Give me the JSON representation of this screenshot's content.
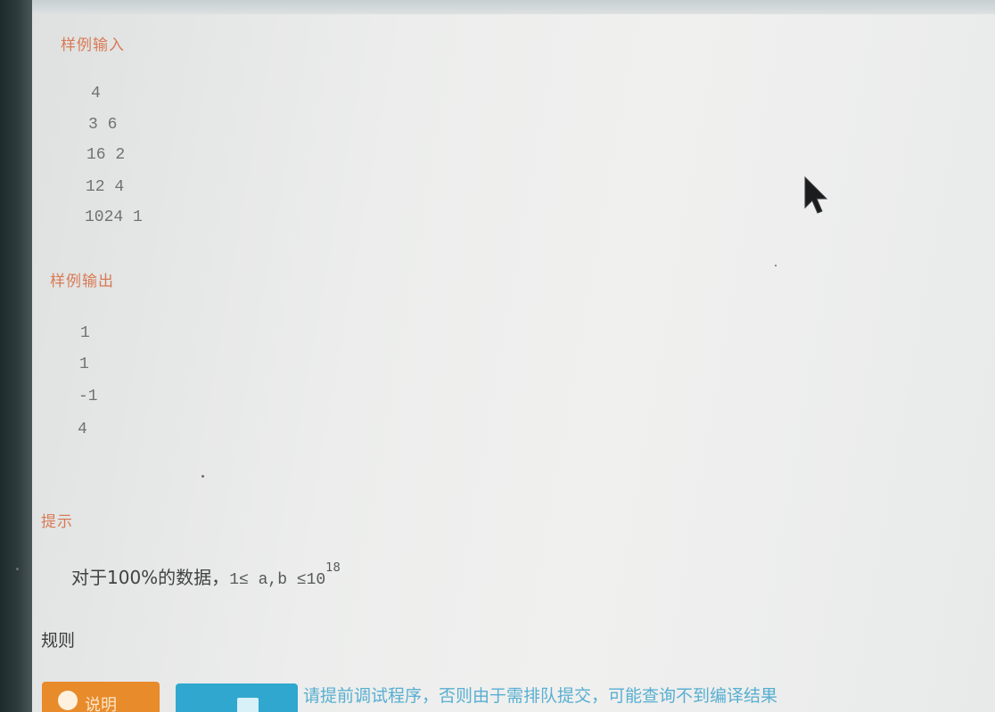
{
  "sample_input": {
    "title": "样例输入",
    "lines": [
      "4",
      "3 6",
      "16 2",
      "12 4",
      "1024 1"
    ]
  },
  "sample_output": {
    "title": "样例输出",
    "lines": [
      "1",
      "1",
      "-1",
      "4"
    ]
  },
  "hint": {
    "title": "提示",
    "prefix": "对于100%的数据，",
    "constraint": "1≤ a,b ≤10",
    "exponent": "18"
  },
  "rules": {
    "title": "规则"
  },
  "actions": {
    "orange_button_label": "说明",
    "blue_button_label": "",
    "notice": "请提前调试程序，否则由于需排队提交，可能查询不到编译结果"
  },
  "colors": {
    "section_title": "#d87a55",
    "orange_button": "#e88b2a",
    "blue_button": "#2fa7cf",
    "notice": "#48a9cf"
  }
}
